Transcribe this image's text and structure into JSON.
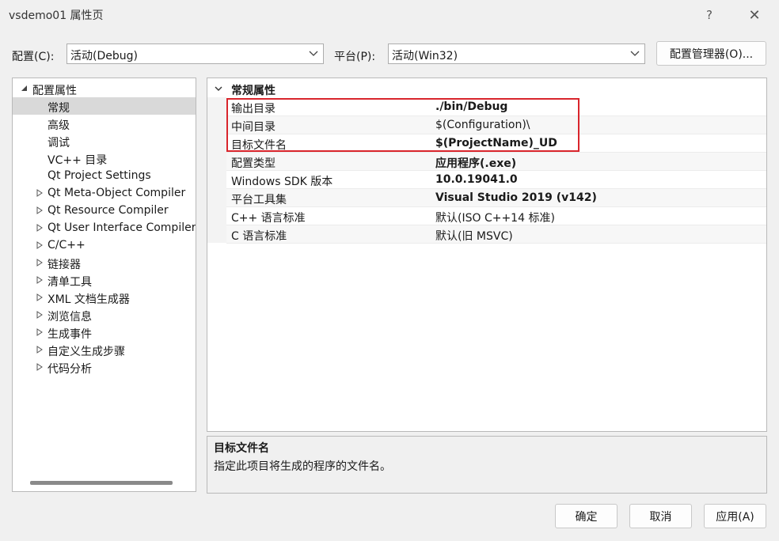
{
  "window": {
    "title": "vsdemo01 属性页",
    "help": "?",
    "close": "✕"
  },
  "config": {
    "label": "配置(C):",
    "value": "活动(Debug)"
  },
  "platform": {
    "label": "平台(P):",
    "value": "活动(Win32)"
  },
  "config_manager": "配置管理器(O)...",
  "tree": {
    "root": "配置属性",
    "items": [
      "常规",
      "高级",
      "调试",
      "VC++ 目录",
      "Qt Project Settings",
      "Qt Meta-Object Compiler",
      "Qt Resource Compiler",
      "Qt User Interface Compiler",
      "C/C++",
      "链接器",
      "清单工具",
      "XML 文档生成器",
      "浏览信息",
      "生成事件",
      "自定义生成步骤",
      "代码分析"
    ]
  },
  "grid": {
    "section": "常规属性",
    "rows": [
      {
        "key": "输出目录",
        "value": "./bin/Debug"
      },
      {
        "key": "中间目录",
        "value": "$(Configuration)\\"
      },
      {
        "key": "目标文件名",
        "value": "$(ProjectName)_UD"
      },
      {
        "key": "配置类型",
        "value": "应用程序(.exe)"
      },
      {
        "key": "Windows SDK 版本",
        "value": "10.0.19041.0"
      },
      {
        "key": "平台工具集",
        "value": "Visual Studio 2019 (v142)"
      },
      {
        "key": "C++ 语言标准",
        "value": "默认(ISO C++14 标准)"
      },
      {
        "key": "C 语言标准",
        "value": "默认(旧 MSVC)"
      }
    ]
  },
  "description": {
    "title": "目标文件名",
    "text": "指定此项目将生成的程序的文件名。"
  },
  "buttons": {
    "ok": "确定",
    "cancel": "取消",
    "apply": "应用(A)"
  }
}
